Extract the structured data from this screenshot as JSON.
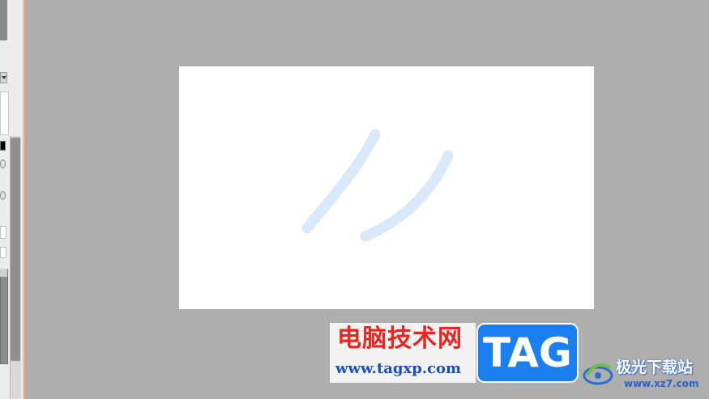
{
  "canvas": {
    "background_color": "#ffffff",
    "stroke_color": "#d9e9f9",
    "strokes": [
      "stroke-1",
      "stroke-2"
    ]
  },
  "watermark": {
    "site_name": "电脑技术网",
    "site_url": "www.tagxp.com",
    "tag_label": "TAG",
    "tag_color": "#1a7ff0",
    "logo_name": "极光下载站",
    "logo_url": "www.xz7.com"
  },
  "left_panel": {
    "color_swatch": "#000000"
  }
}
